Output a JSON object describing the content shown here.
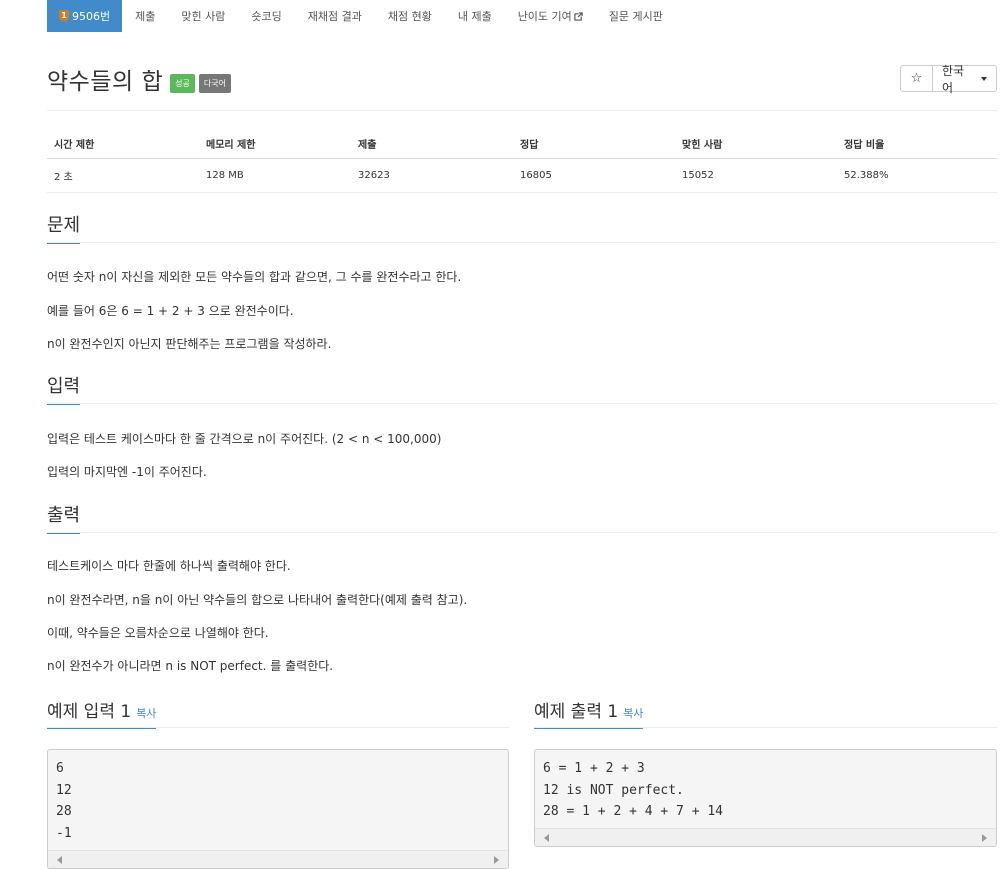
{
  "nav": {
    "items": [
      {
        "label": "9506번",
        "active": true,
        "tier_icon": "1"
      },
      {
        "label": "제출"
      },
      {
        "label": "맞힌 사람"
      },
      {
        "label": "숏코딩"
      },
      {
        "label": "재채점 결과"
      },
      {
        "label": "채점 현황"
      },
      {
        "label": "내 제출"
      },
      {
        "label": "난이도 기여",
        "icon": "external-link-icon"
      },
      {
        "label": "질문 게시판"
      }
    ]
  },
  "problem": {
    "title": "약수들의 합",
    "label_success": "성공",
    "label_lang": "다국어",
    "star_icon": "☆",
    "language_select": "한국어"
  },
  "info_table": {
    "headers": [
      "시간 제한",
      "메모리 제한",
      "제출",
      "정답",
      "맞힌 사람",
      "정답 비율"
    ],
    "values": [
      "2 초",
      "128 MB",
      "32623",
      "16805",
      "15052",
      "52.388%"
    ]
  },
  "sections": {
    "problem": {
      "title": "문제",
      "paragraphs": [
        "어떤 숫자 n이 자신을 제외한 모든 약수들의 합과 같으면, 그 수를 완전수라고 한다.",
        "예를 들어 6은 6 = 1 + 2 + 3 으로 완전수이다.",
        "n이 완전수인지 아닌지 판단해주는 프로그램을 작성하라."
      ]
    },
    "input": {
      "title": "입력",
      "paragraphs": [
        "입력은 테스트 케이스마다 한 줄 간격으로 n이 주어진다. (2 < n < 100,000)",
        "입력의 마지막엔 -1이 주어진다."
      ]
    },
    "output": {
      "title": "출력",
      "paragraphs": [
        "테스트케이스 마다 한줄에 하나씩 출력해야 한다.",
        "n이 완전수라면, n을 n이 아닌 약수들의 합으로 나타내어 출력한다(예제 출력 참고).",
        "이때, 약수들은 오름차순으로 나열해야 한다.",
        "n이 완전수가 아니라면 n is NOT perfect. 를 출력한다."
      ]
    }
  },
  "samples": {
    "input": {
      "title": "예제 입력 1",
      "copy_label": "복사",
      "content": "6\n12\n28\n-1"
    },
    "output": {
      "title": "예제 출력 1",
      "copy_label": "복사",
      "content": "6 = 1 + 2 + 3\n12 is NOT perfect.\n28 = 1 + 2 + 4 + 7 + 14"
    }
  }
}
